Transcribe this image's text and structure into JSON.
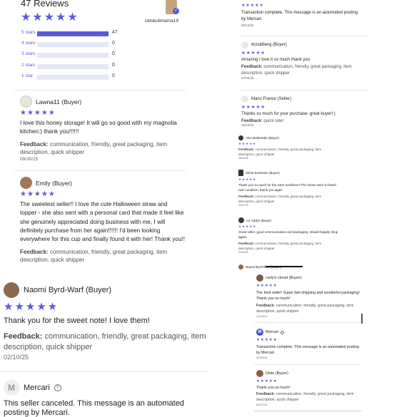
{
  "summary": {
    "title": "47 Reviews",
    "stars": "★★★★★",
    "username": "oldskullmama19",
    "bars": [
      {
        "label": "5 stars",
        "count": "47",
        "fraction": 1.0
      },
      {
        "label": "4 stars",
        "count": "0",
        "fraction": 0
      },
      {
        "label": "3 stars",
        "count": "0",
        "fraction": 0
      },
      {
        "label": "2 stars",
        "count": "0",
        "fraction": 0
      },
      {
        "label": "1 star",
        "count": "0",
        "fraction": 0
      }
    ]
  },
  "feedback_label": "Feedback:",
  "left_reviews": [
    {
      "name": "Lawna11 (Buyer)",
      "stars": "★★★★★",
      "text": "I love this honey storage! It will go so good with my magnolia kitchen:) thank you!!!!!!",
      "feedback": "communication, friendly, great packaging, item description, quick shipper",
      "date": "09/30/25"
    },
    {
      "name": "Emily (Buyer)",
      "stars": "★★★★★",
      "text": "The sweetest seller!! I love the cute Halloween straw and topper - she also sent with a personal card that made it feel like she genuinely appreciated doing business with me, I will definitely purchase from her again!!!!!! I'd been looking everywhere for this cup and finally found it with her! Thank you!!",
      "feedback": "communication, friendly, great packaging, item description, quick shipper",
      "date": ""
    }
  ],
  "big_review": {
    "name": "Naomi Byrd-Warf (Buyer)",
    "stars": "★★★★★",
    "text": "Thank you for the sweet note!  I love them!",
    "feedback": "communication, friendly, great packaging, item description, quick shipper",
    "date": "02/10/25"
  },
  "mercari_bottom": {
    "name": "Mercari",
    "text": "This seller canceled. This message is an automated",
    "text2": "posting by Mercari."
  },
  "right_top": [
    {
      "name": "",
      "stars": "★★★★★",
      "text": "Transaction complete. This message is an automated posting by Mercari.",
      "feedback": "",
      "date": "08/12/25"
    },
    {
      "name": "drzoidberg (Buyer)",
      "stars": "★★★★★",
      "text": "Amazing I love it so much thank you",
      "feedback": "communication, friendly, great packaging, item description, quick shipper",
      "date": "07/25/25"
    },
    {
      "name": "Marci France (Seller)",
      "stars": "★★★★★",
      "text": "Thanks so much for your purchase- great buyer!:)",
      "feedback": "quick rater",
      "date": "06/23/25"
    }
  ],
  "right_small": [
    {
      "name": "Alex Brabender (Buyer)",
      "stars": "★★★★★",
      "text": "",
      "feedback": "communication, friendly, great packaging, item description, quick shipper",
      "date": "06/19/25"
    },
    {
      "name": "Olivia Sorensen (Buyer)",
      "stars": "★★★★★",
      "text": "Thank you so much for the extra necklace!! The shoes were in brand new condition, thank you again",
      "feedback": "communication, friendly, great packaging, item description, quick shipper",
      "date": "05/07/25"
    },
    {
      "name": "Liz Addict (Buyer)",
      "stars": "★★★★★",
      "text": "Great seller, good communication and packaging. Would happily shop again.",
      "feedback": "communication, friendly, great packaging, item description, quick shipper",
      "date": "04/04/25"
    },
    {
      "name": "Naomi Byrd-Warf (Buyer)",
      "stars": "",
      "text": "",
      "feedback": "",
      "date": ""
    }
  ],
  "right_bottom": [
    {
      "name": "carly's closet (Buyer)",
      "stars": "★★★★★",
      "text": "The best seller! Super fast shipping and wonderful packaging! Thank you so much!",
      "feedback": "communication, friendly, great packaging, item description, quick shipper",
      "date": "12/23/24"
    },
    {
      "name": "Mercari",
      "stars": "★★★★★",
      "text": "Transaction complete. This message is an automated posting by Mercari.",
      "feedback": "",
      "date": "10/30/24"
    },
    {
      "name": "Dixie (Buyer)",
      "stars": "★★★★★",
      "text": "Thank you so much!",
      "feedback": "communication, friendly, great packaging, item description, quick shipper",
      "date": "09/27/24"
    }
  ],
  "colors": {
    "accent": "#5a5bd8"
  }
}
